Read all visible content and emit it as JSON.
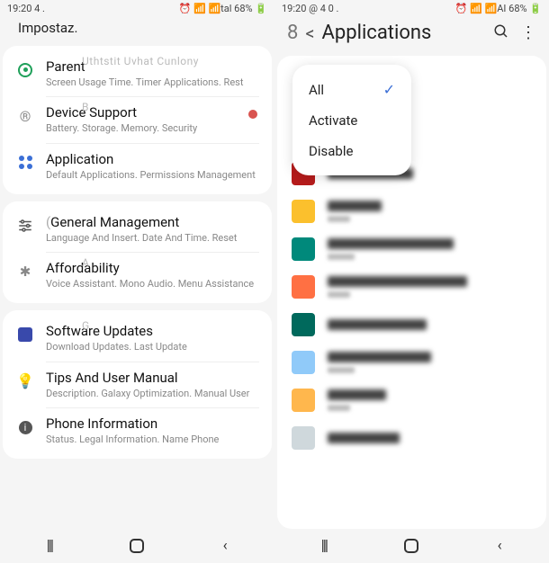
{
  "left": {
    "status": {
      "time": "19:20 4 .",
      "right": "⏰ 📶 📶tal 68% 🔋"
    },
    "header": "Impostaz.",
    "groups": [
      {
        "items": [
          {
            "icon": "wellbeing",
            "title": "Parent",
            "sub": "Screen Usage Time. Timer Applications. Rest",
            "dot": false,
            "ghost_over": "Uthtstit Uvhat Cunlony"
          },
          {
            "icon": "registered",
            "title": "Device Support",
            "sub": "Battery. Storage. Memory. Security",
            "dot": true,
            "ghost_over": "B"
          },
          {
            "icon": "apps",
            "title": "Application",
            "sub": "Default Applications. Permissions Management",
            "dot": false
          }
        ]
      },
      {
        "items": [
          {
            "icon": "sliders",
            "title": "General Management",
            "sub": "Language And Insert. Date And Time. Reset",
            "dot": false,
            "ghost_paren": "("
          },
          {
            "icon": "star",
            "title": "Affordability",
            "sub": "Voice Assistant. Mono Audio. Menu Assistance",
            "dot": false,
            "ghost_over": "A"
          }
        ]
      },
      {
        "items": [
          {
            "icon": "update",
            "title": "Software Updates",
            "sub": "Download Updates. Last Update",
            "dot": false,
            "ghost_over": "G"
          },
          {
            "icon": "bulb",
            "title": "Tips And User Manual",
            "sub": "Description. Galaxy Optimization. Manual User",
            "dot": false
          },
          {
            "icon": "info",
            "title": "Phone Information",
            "sub": "Status. Legal Information. Name Phone",
            "dot": false
          }
        ]
      }
    ]
  },
  "right": {
    "status": {
      "time": "19:20 @ 4 0 .",
      "right": "⏰ 📶 📶AI 68% 🔋"
    },
    "header": {
      "back": "<",
      "title": "Applications",
      "prefix": "8"
    },
    "dropdown": [
      {
        "label": "All",
        "checked": true
      },
      {
        "label": "Activate",
        "checked": false
      },
      {
        "label": "Disable",
        "checked": false
      }
    ],
    "apps": [
      {
        "iconColor": "#b71c1c",
        "nameW": 95,
        "subW": 0
      },
      {
        "iconColor": "#fbc02d",
        "nameW": 60,
        "subW": 25
      },
      {
        "iconColor": "#00897b",
        "nameW": 140,
        "subW": 30
      },
      {
        "iconColor": "#ff7043",
        "nameW": 155,
        "subW": 25
      },
      {
        "iconColor": "#00695c",
        "nameW": 110,
        "subW": 0
      },
      {
        "iconColor": "#90caf9",
        "nameW": 115,
        "subW": 30
      },
      {
        "iconColor": "#ffb74d",
        "nameW": 65,
        "subW": 25
      },
      {
        "iconColor": "#cfd8dc",
        "nameW": 80,
        "subW": 0
      }
    ]
  },
  "nav": {
    "recents": "|||",
    "home": "◻",
    "back": "‹"
  }
}
